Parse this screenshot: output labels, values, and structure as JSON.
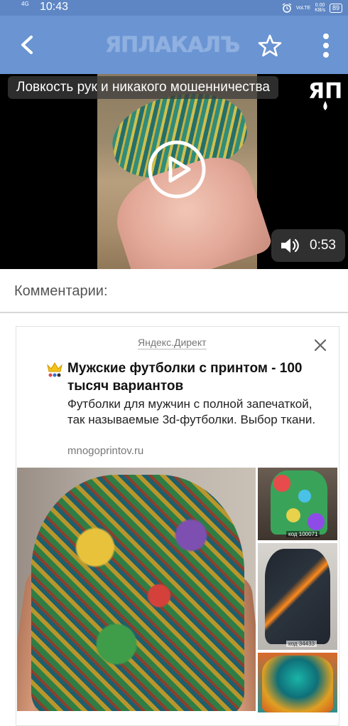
{
  "status_bar": {
    "network": "4G",
    "time": "10:43",
    "volte": "VoLTE",
    "speed_value": "0.00",
    "speed_unit": "KB/s",
    "battery": "89"
  },
  "toolbar": {
    "logo_text": "ЯПЛАКАЛЪ",
    "back_icon": "arrow-back-icon",
    "star_icon": "star-outline-icon",
    "menu_icon": "more-vertical-icon",
    "bg_color": "#6a94d2"
  },
  "video": {
    "title": "Ловкость рук и никакого мошенничества",
    "watermark": "ЯП",
    "duration": "0:53"
  },
  "comments": {
    "heading": "Комментарии:"
  },
  "ad": {
    "source": "Яндекс.Директ",
    "title": "Мужские футболки с принтом - 100 тысяч вариантов",
    "description": "Футболки для мужчин с полной запечаткой, так называемые 3d-футболки. Выбор ткани.",
    "url": "mnogoprintov.ru",
    "thumb_codes": [
      "код 100071",
      "код 34433"
    ]
  }
}
